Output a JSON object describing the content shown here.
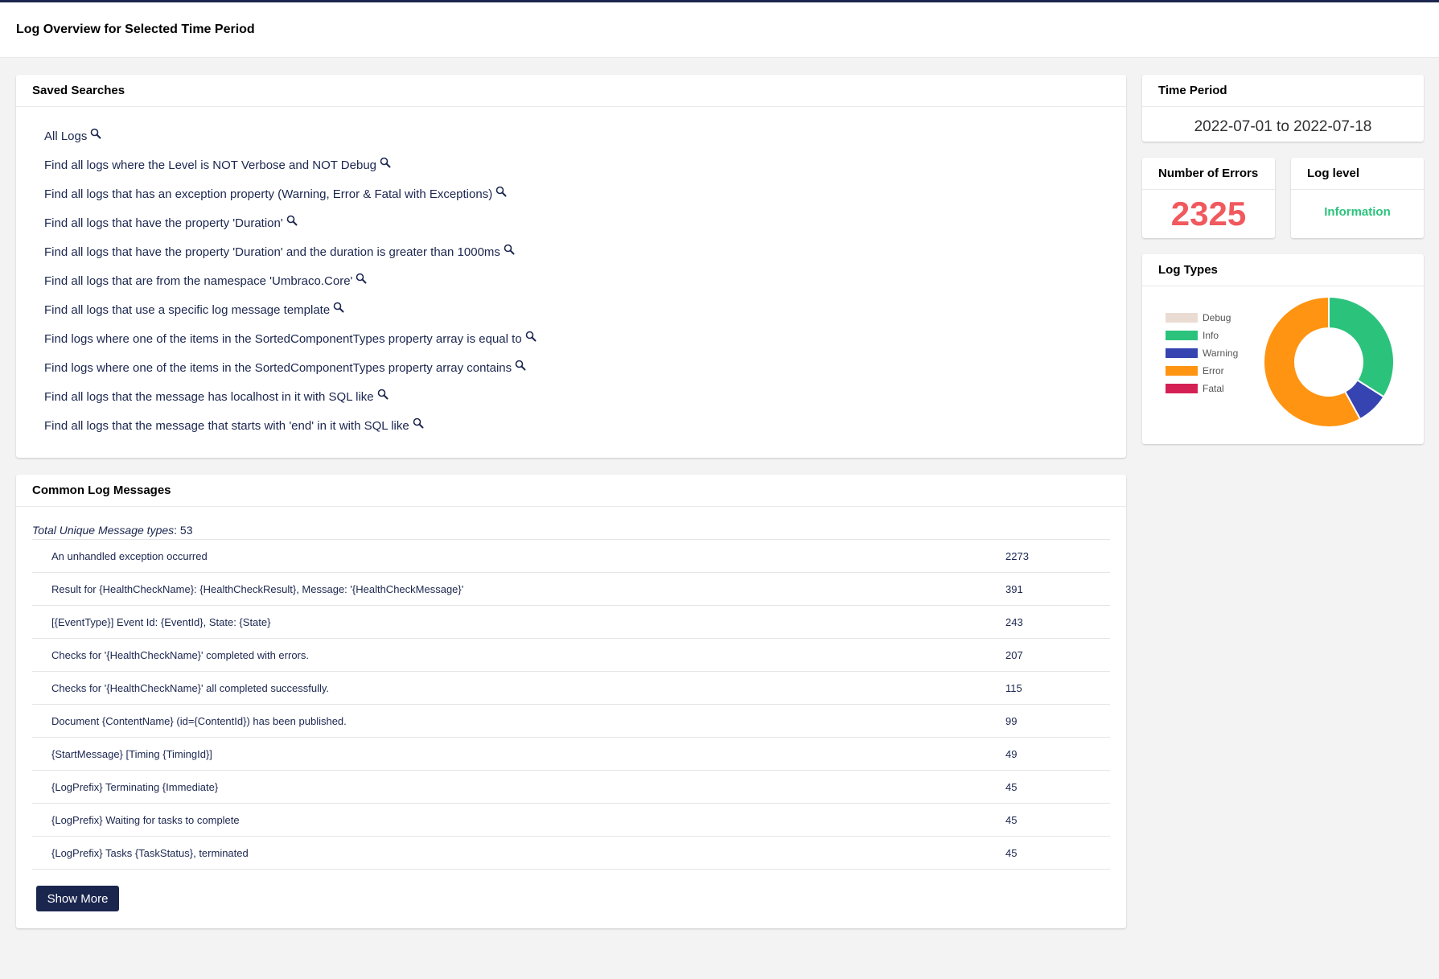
{
  "header": {
    "title": "Log Overview for Selected Time Period"
  },
  "saved_searches": {
    "title": "Saved Searches",
    "items": [
      "All Logs",
      "Find all logs where the Level is NOT Verbose and NOT Debug",
      "Find all logs that has an exception property (Warning, Error & Fatal with Exceptions)",
      "Find all logs that have the property 'Duration'",
      "Find all logs that have the property 'Duration' and the duration is greater than 1000ms",
      "Find all logs that are from the namespace 'Umbraco.Core'",
      "Find all logs that use a specific log message template",
      "Find logs where one of the items in the SortedComponentTypes property array is equal to",
      "Find logs where one of the items in the SortedComponentTypes property array contains",
      "Find all logs that the message has localhost in it with SQL like",
      "Find all logs that the message that starts with 'end' in it with SQL like"
    ]
  },
  "common_messages": {
    "title": "Common Log Messages",
    "total_label": "Total Unique Message types",
    "total_value": ": 53",
    "rows": [
      {
        "message": "An unhandled exception occurred",
        "count": "2273"
      },
      {
        "message": "Result for {HealthCheckName}: {HealthCheckResult}, Message: '{HealthCheckMessage}'",
        "count": "391"
      },
      {
        "message": "[{EventType}] Event Id: {EventId}, State: {State}",
        "count": "243"
      },
      {
        "message": "Checks for '{HealthCheckName}' completed with errors.",
        "count": "207"
      },
      {
        "message": "Checks for '{HealthCheckName}' all completed successfully.",
        "count": "115"
      },
      {
        "message": "Document {ContentName} (id={ContentId}) has been published.",
        "count": "99"
      },
      {
        "message": "{StartMessage} [Timing {TimingId}]",
        "count": "49"
      },
      {
        "message": "{LogPrefix} Terminating {Immediate}",
        "count": "45"
      },
      {
        "message": "{LogPrefix} Waiting for tasks to complete",
        "count": "45"
      },
      {
        "message": "{LogPrefix} Tasks {TaskStatus}, terminated",
        "count": "45"
      }
    ],
    "show_more_label": "Show More"
  },
  "time_period": {
    "title": "Time Period",
    "value": "2022-07-01 to 2022-07-18"
  },
  "errors": {
    "title": "Number of Errors",
    "value": "2325"
  },
  "log_level": {
    "title": "Log level",
    "value": "Information"
  },
  "log_types": {
    "title": "Log Types"
  },
  "icons": {
    "search": "magnifier-icon"
  },
  "colors": {
    "accent": "#1b264f",
    "error_number": "#f0595d",
    "level_text": "#2bc37c"
  },
  "chart_data": {
    "type": "pie",
    "variant": "doughnut",
    "legend_position": "left",
    "categories": [
      "Debug",
      "Info",
      "Warning",
      "Error",
      "Fatal"
    ],
    "values": [
      0,
      34,
      8,
      58,
      0
    ],
    "colors": [
      "#eadcd3",
      "#2bc37c",
      "#3544b1",
      "#ff9412",
      "#d42054"
    ]
  }
}
